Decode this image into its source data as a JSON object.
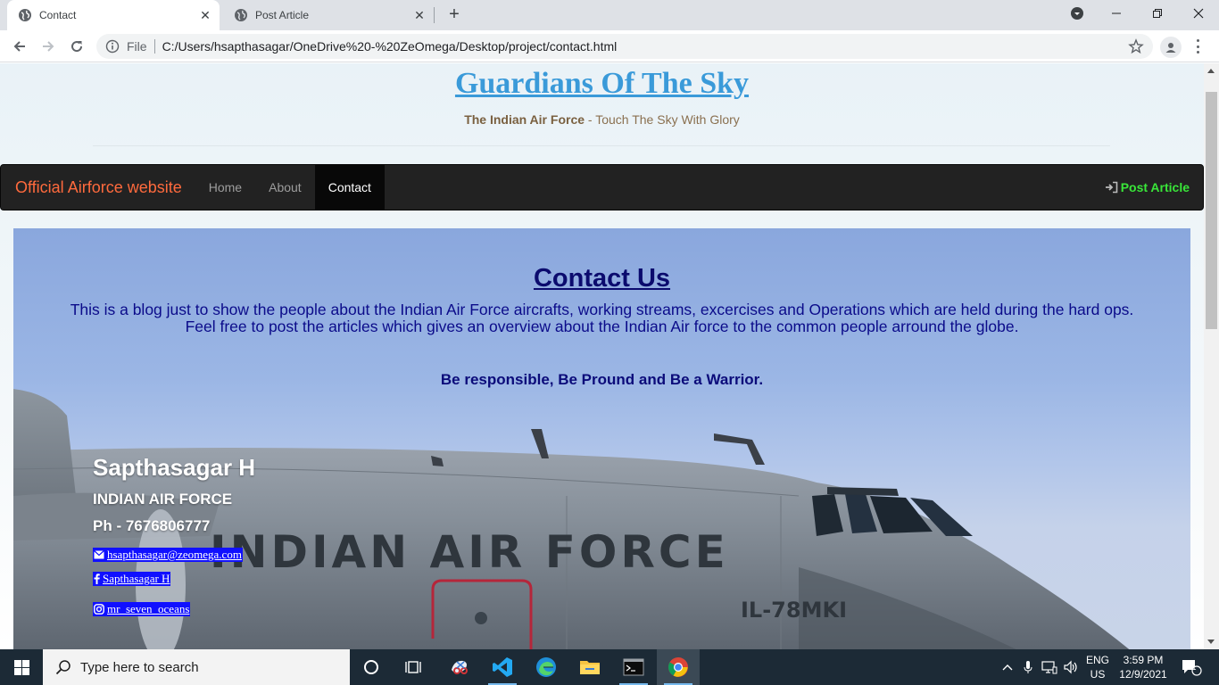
{
  "browser": {
    "tabs": [
      {
        "label": "Contact",
        "active": true
      },
      {
        "label": "Post Article",
        "active": false
      }
    ],
    "omnibox": {
      "scheme_label": "File",
      "url": "C:/Users/hsapthasagar/OneDrive%20-%20ZeOmega/Desktop/project/contact.html"
    }
  },
  "site": {
    "title": "Guardians Of The Sky",
    "tagline_bold": "The Indian Air Force",
    "tagline_rest": " - Touch The Sky With Glory"
  },
  "navbar": {
    "brand": "Official Airforce website",
    "links": [
      "Home",
      "About",
      "Contact"
    ],
    "active_link": "Contact",
    "post_article": "Post Article"
  },
  "contact": {
    "heading": "Contact Us",
    "description_line1": "This is a blog just to show the people about the Indian Air Force aircrafts, working streams, excercises and Operations which are held during the hard ops.",
    "description_line2": "Feel free to post the articles which gives an overview about the Indian Air force to the common people arround the globe.",
    "motto": "Be responsible, Be Pround and Be a Warrior.",
    "person": {
      "name": "Sapthasagar H",
      "organization": "INDIAN AIR FORCE",
      "phone": "Ph - 7676806777",
      "email": "hsapthasagar@zeomega.com",
      "facebook": "Sapthasagar H",
      "instagram": "mr_seven_oceans"
    },
    "hero_image": {
      "fuselage_text": "INDIAN AIR FORCE",
      "registration": "IL-78MKI"
    }
  },
  "taskbar": {
    "search_placeholder": "Type here to search",
    "language": "ENG",
    "region": "US",
    "time": "3:59 PM",
    "date": "12/9/2021",
    "notification_count": "1"
  },
  "colors": {
    "title_blue": "#3a9ad9",
    "brand_orange": "#ff6a3d",
    "post_green": "#39e639",
    "navbar_bg": "#222222",
    "social_highlight": "#1010ff"
  }
}
